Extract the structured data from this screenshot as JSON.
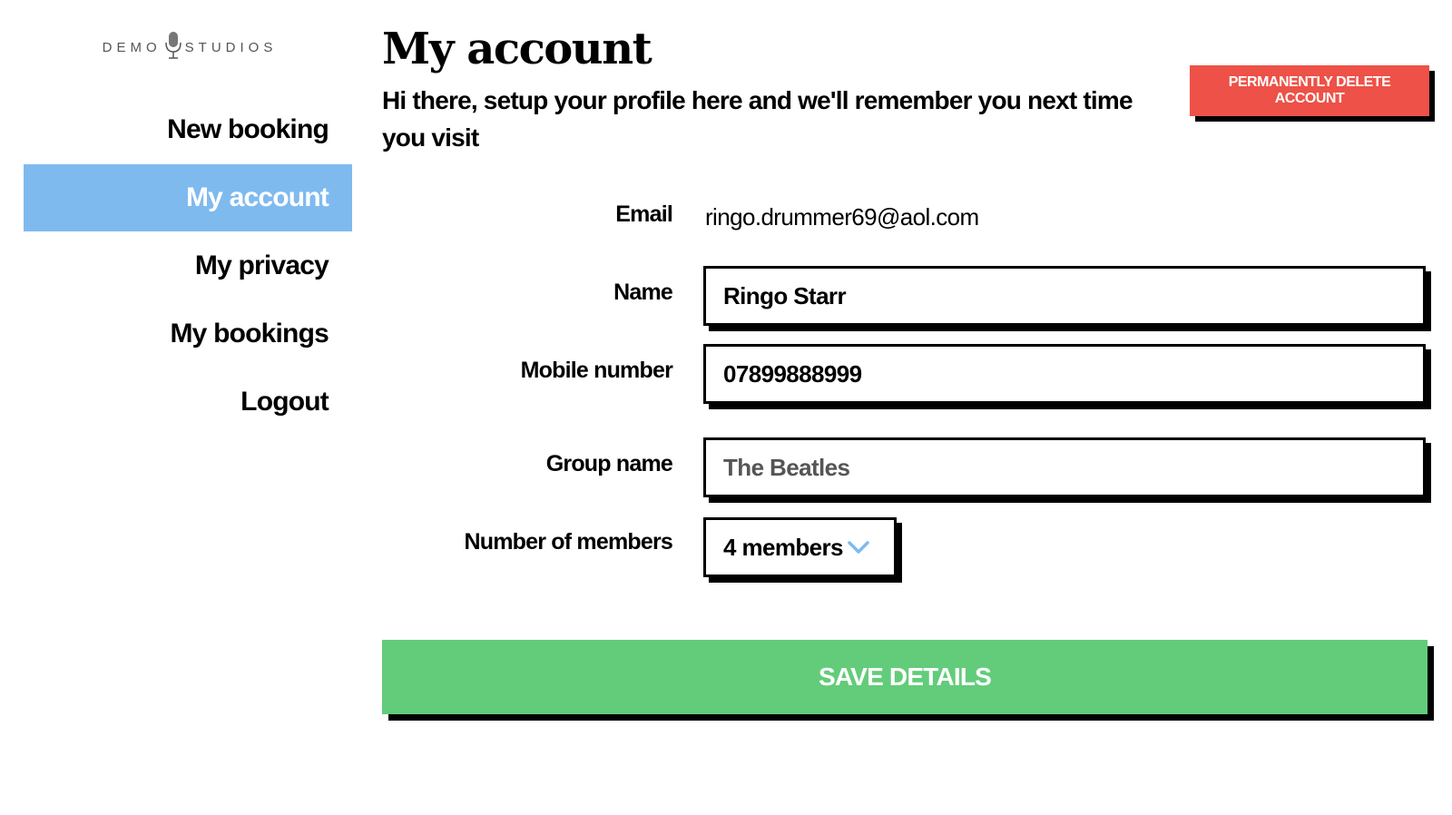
{
  "logo": {
    "left_text": "DEMO",
    "right_text": "STUDIOS",
    "icon": "microphone-icon"
  },
  "sidebar": {
    "items": [
      {
        "label": "New booking",
        "active": false
      },
      {
        "label": "My account",
        "active": true
      },
      {
        "label": "My privacy",
        "active": false
      },
      {
        "label": "My bookings",
        "active": false
      },
      {
        "label": "Logout",
        "active": false
      }
    ],
    "active_color": "#7fbaef"
  },
  "main": {
    "title": "My account",
    "subtitle": "Hi there, setup your profile here and we'll remember you next time you visit",
    "delete_button": "PERMANENTLY DELETE ACCOUNT",
    "delete_color": "#ed5147"
  },
  "form": {
    "email_label": "Email",
    "email_value": "ringo.drummer69@aol.com",
    "name_label": "Name",
    "name_value": "Ringo Starr",
    "mobile_label": "Mobile number",
    "mobile_value": "07899888999",
    "group_label": "Group name",
    "group_placeholder": "The Beatles",
    "members_label": "Number of members",
    "members_value": "4 members",
    "save_button": "SAVE DETAILS",
    "save_color": "#62cc7a",
    "chevron_color": "#7fbaef"
  }
}
